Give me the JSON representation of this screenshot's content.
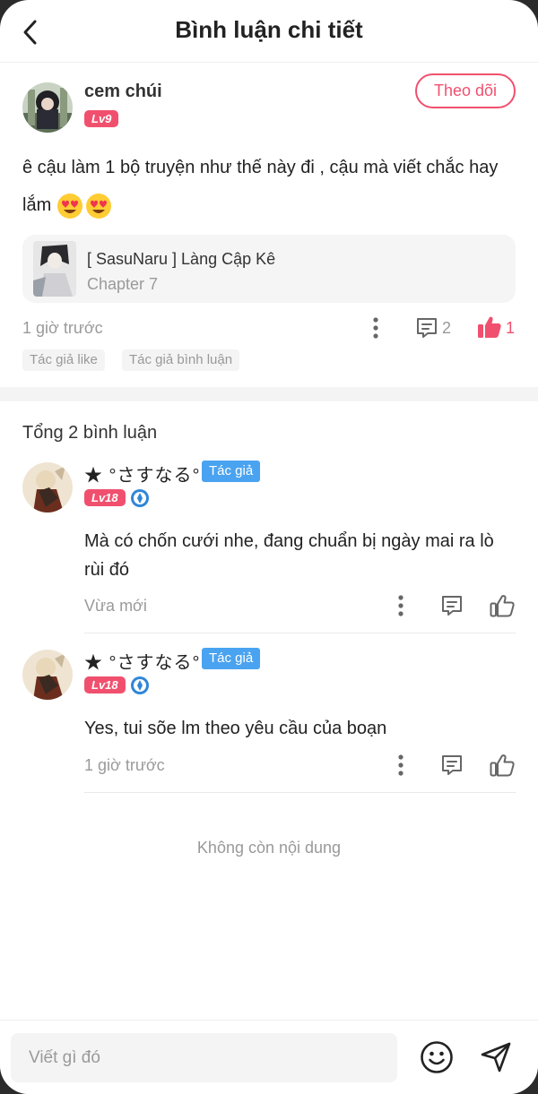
{
  "header": {
    "title": "Bình luận chi tiết"
  },
  "main_comment": {
    "username": "cem chúi",
    "level": "Lv9",
    "follow_label": "Theo dõi",
    "text": "ê cậu làm 1 bộ truyện như thế này đi , cậu mà viết chắc hay lắm",
    "emojis": [
      "heart-eyes-emoji",
      "heart-eyes-emoji"
    ],
    "story": {
      "name": "[ SasuNaru ] Làng Cập Kê",
      "chapter": "Chapter 7"
    },
    "time": "1 giờ trước",
    "reply_count": "2",
    "like_count": "1",
    "tags": [
      "Tác giả like",
      "Tác giả bình luận"
    ],
    "colors": {
      "accent": "#f0506e",
      "author_badge": "#4aa3f0"
    }
  },
  "replies_header": "Tổng 2 bình luận",
  "replies": [
    {
      "name": "★ °さすなる°",
      "author_badge": "Tác giả",
      "level": "Lv18",
      "text": "Mà có chốn cưới nhe, đang chuẩn bị ngày mai ra lò rùi đó",
      "time": "Vừa mới"
    },
    {
      "name": "★ °さすなる°",
      "author_badge": "Tác giả",
      "level": "Lv18",
      "text": "Yes, tui sõe lm theo yêu cầu của boạn",
      "time": "1 giờ trước"
    }
  ],
  "end_note": "Không còn nội dung",
  "composer": {
    "placeholder": "Viết gì đó"
  }
}
